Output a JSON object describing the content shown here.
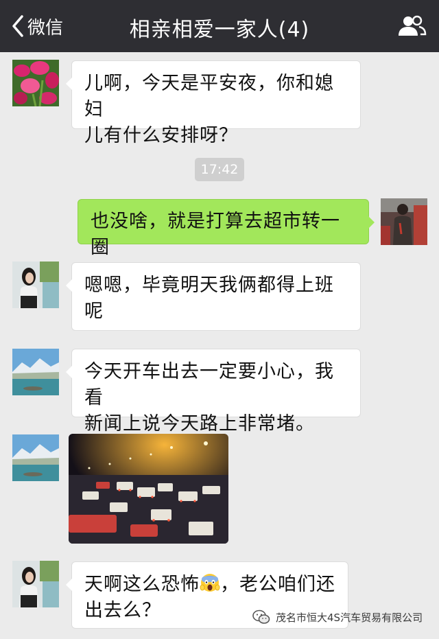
{
  "header": {
    "back_label": "微信",
    "title": "相亲相爱一家人(4)"
  },
  "messages": [
    {
      "sender": "mom",
      "text_line1": "儿啊，今天是平安夜，你和媳妇",
      "text_line2": "儿有什么安排呀？"
    },
    {
      "sender": "me",
      "text": "也没啥，就是打算去超市转一圈"
    },
    {
      "sender": "wife",
      "text": "嗯嗯，毕竟明天我俩都得上班呢"
    },
    {
      "sender": "dad",
      "text_line1": "今天开车出去一定要小心，我看",
      "text_line2": "新闻上说今天路上非常堵。"
    },
    {
      "sender": "dad",
      "type": "image",
      "image": "night-traffic-jam-photo"
    },
    {
      "sender": "wife",
      "text_line1_a": "天啊这么恐怖",
      "emoji": "scream-emoji",
      "text_line1_b": "，老公咱们还",
      "text_line2": "出去么？"
    }
  ],
  "timestamp": "17:42",
  "watermark": "茂名市恒大4S汽车贸易有限公司",
  "colors": {
    "topbar": "#2e2e33",
    "background": "#ebebeb",
    "my_bubble": "#a2e75b",
    "other_bubble": "#ffffff"
  },
  "icons": [
    "chevron-left-icon",
    "contacts-icon",
    "wechat-logo-icon"
  ]
}
